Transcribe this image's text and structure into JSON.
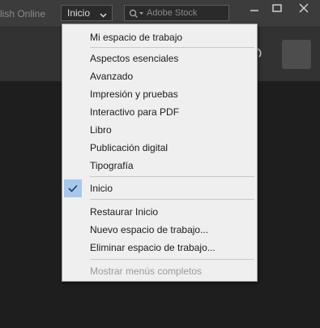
{
  "titlebar": {
    "publish_online": "lish Online",
    "workspace_switcher": "Inicio",
    "search_placeholder": "Adobe Stock"
  },
  "menu": {
    "items": [
      {
        "label": "Mi espacio de trabajo"
      },
      {
        "label": "Aspectos esenciales"
      },
      {
        "label": "Avanzado"
      },
      {
        "label": "Impresión y pruebas"
      },
      {
        "label": "Interactivo para PDF"
      },
      {
        "label": "Libro"
      },
      {
        "label": "Publicación digital"
      },
      {
        "label": "Tipografía"
      },
      {
        "label": "Inicio",
        "checked": true
      },
      {
        "label": "Restaurar Inicio"
      },
      {
        "label": "Nuevo espacio de trabajo..."
      },
      {
        "label": "Eliminar espacio de trabajo..."
      },
      {
        "label": "Mostrar menús completos",
        "disabled": true
      }
    ]
  },
  "colors": {
    "titlebar": "#3c3c3c",
    "canvas": "#1e1e1e",
    "menu_bg": "#efefef",
    "check_highlight": "#a8c8ea"
  }
}
